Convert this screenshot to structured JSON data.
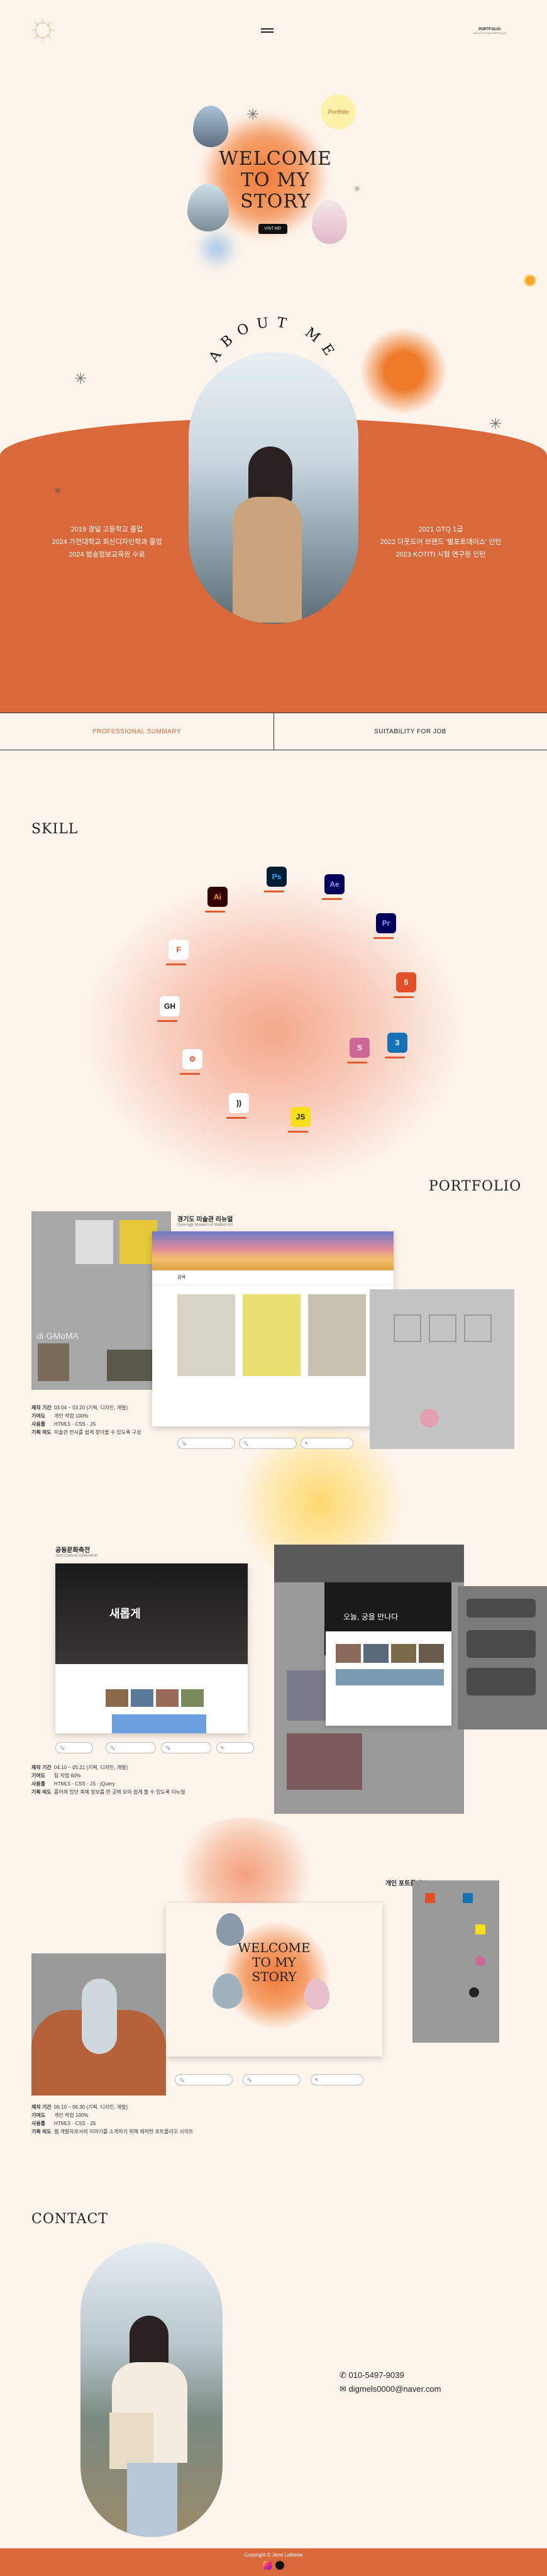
{
  "header": {
    "right_title": "PORTFOLIO",
    "right_sub": "KIM SEO HYUN PORTFOLIO"
  },
  "hero": {
    "title_line1": "WELCOME",
    "title_line2": "TO MY",
    "title_line3": "STORY",
    "button_label": "VISIT ME!",
    "sticker_text": "Portfolio"
  },
  "about": {
    "arc_title": "ABOUT ME",
    "left_lines": [
      "2019 경일 고등학교 졸업",
      "2024 가천대학교 회산디자인학과 졸업",
      "2024 범송정보교육원 수료"
    ],
    "right_lines": [
      "2021 GTQ 1급",
      "2022 더웃도어 브랜드 '별포토데이쇼' 인턴",
      "2023 KOTITI 시험 연구원 인턴"
    ]
  },
  "tabs": {
    "left": "PROFESSIONAL SUMMARY",
    "right": "SUITABILITY FOR JOB"
  },
  "skill": {
    "title": "SKILL",
    "icons": [
      {
        "name": "illustrator-icon",
        "label": "Ai",
        "color": "#330000",
        "text": "#ff9a00"
      },
      {
        "name": "photoshop-icon",
        "label": "Ps",
        "color": "#001e36",
        "text": "#31a8ff"
      },
      {
        "name": "after-effects-icon",
        "label": "Ae",
        "color": "#00005b",
        "text": "#9999ff"
      },
      {
        "name": "premiere-icon",
        "label": "Pr",
        "color": "#00005b",
        "text": "#9999ff"
      },
      {
        "name": "figma-icon",
        "label": "F",
        "color": "#ffffff",
        "text": "#f24e1e"
      },
      {
        "name": "html5-icon",
        "label": "5",
        "color": "#e34f26",
        "text": "#ffffff"
      },
      {
        "name": "github-icon",
        "label": "GH",
        "color": "#ffffff",
        "text": "#111111"
      },
      {
        "name": "css3-icon",
        "label": "3",
        "color": "#1572b6",
        "text": "#ffffff"
      },
      {
        "name": "sass-icon",
        "label": "S",
        "color": "#cd6799",
        "text": "#ffffff"
      },
      {
        "name": "gear-icon",
        "label": "⚙",
        "color": "#ffffff",
        "text": "#e05a2a"
      },
      {
        "name": "jquery-icon",
        "label": "))",
        "color": "#ffffff",
        "text": "#111111"
      },
      {
        "name": "javascript-icon",
        "label": "JS",
        "color": "#f7df1e",
        "text": "#222222"
      }
    ]
  },
  "portfolio": {
    "title": "PORTFOLIO",
    "p1": {
      "title": "경기도 미술관 리뉴얼",
      "subtitle": "Gyeonggi Museum of Modern Art",
      "nav_label": "검색",
      "watermark": "di·GMoMA",
      "meta": [
        {
          "label": "제작 기간",
          "value": "03.04 ~ 03.20 (기획, 디자인, 개발)"
        },
        {
          "label": "기여도",
          "value": "개인 작업 100%"
        },
        {
          "label": "사용툴",
          "value": "HTML5 · CSS · JS"
        },
        {
          "label": "기획 의도",
          "value": "미술관 전시를 쉽게 찾아볼 수 있도록 구성"
        }
      ]
    },
    "p2": {
      "title": "공동문화축전",
      "subtitle": "Joint Cultural Celebration",
      "hero_text": "새롭게",
      "section_text": "오늘, 궁을 만나다",
      "meta": [
        {
          "label": "제작 기간",
          "value": "04.10 ~ 05.21 (기획, 디자인, 개발)"
        },
        {
          "label": "기여도",
          "value": "팀 작업 60%"
        },
        {
          "label": "사용툴",
          "value": "HTML5 · CSS · JS · jQuery"
        },
        {
          "label": "기획 의도",
          "value": "흩어져 있던 축제 정보를 한 곳에 모아 쉽게 볼 수 있도록 리뉴얼"
        }
      ]
    },
    "p3": {
      "title": "개인 포트폴리오",
      "subtitle": "Portfolio",
      "meta": [
        {
          "label": "제작 기간",
          "value": "06.10 ~ 06.30 (기획, 디자인, 개발)"
        },
        {
          "label": "기여도",
          "value": "개인 작업 100%"
        },
        {
          "label": "사용툴",
          "value": "HTML5 · CSS · JS"
        },
        {
          "label": "기획 의도",
          "value": "웹 개발자로서의 이야기를 소개하기 위해 제작한 포트폴리오 사이트"
        }
      ]
    }
  },
  "contact": {
    "title": "CONTACT",
    "phone": "010-5497-9039",
    "email": "digmels0000@naver.com"
  },
  "footer": {
    "copyright": "Copyright © Jena Lafinisie"
  }
}
